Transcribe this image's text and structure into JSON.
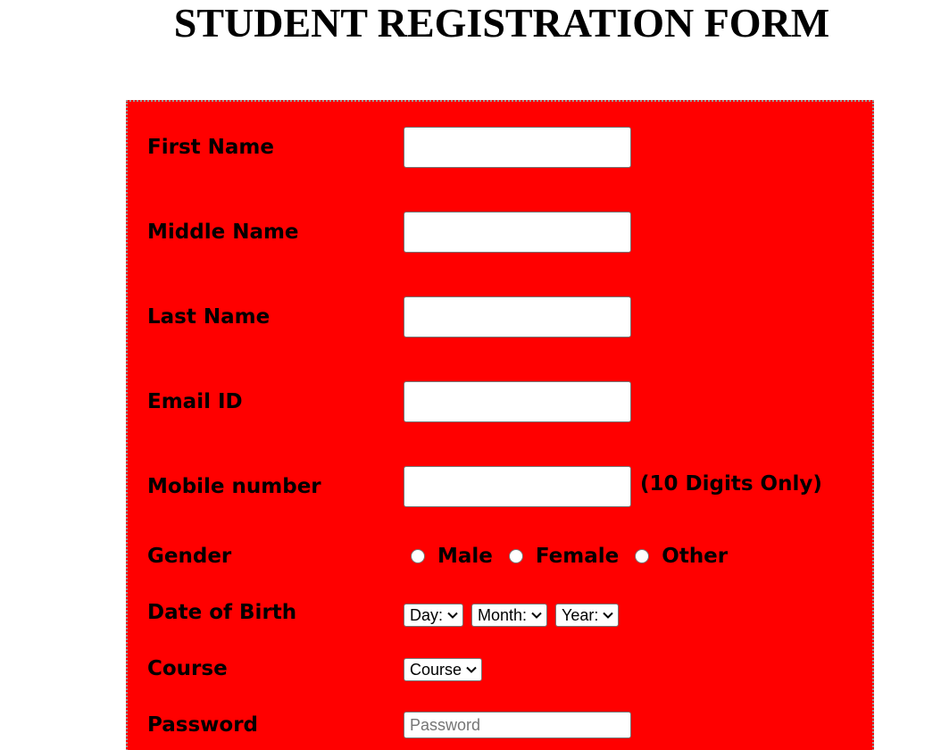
{
  "page": {
    "title": "STUDENT REGISTRATION FORM"
  },
  "form": {
    "first_name_label": "First Name",
    "middle_name_label": "Middle Name",
    "last_name_label": "Last Name",
    "email_label": "Email ID",
    "mobile_label": "Mobile number",
    "mobile_hint": "(10 Digits Only)",
    "gender_label": "Gender",
    "gender_options": [
      "Male",
      "Female",
      "Other"
    ],
    "dob_label": "Date of Birth",
    "dob_day": "Day:",
    "dob_month": "Month:",
    "dob_year": "Year:",
    "course_label": "Course",
    "course_select": "Course",
    "password_label": "Password",
    "password_placeholder": "Password"
  },
  "icons": {
    "select_arrow": "chevron-down-icon"
  },
  "colors": {
    "panel_background": "#ff0000",
    "panel_border": "#999999"
  }
}
